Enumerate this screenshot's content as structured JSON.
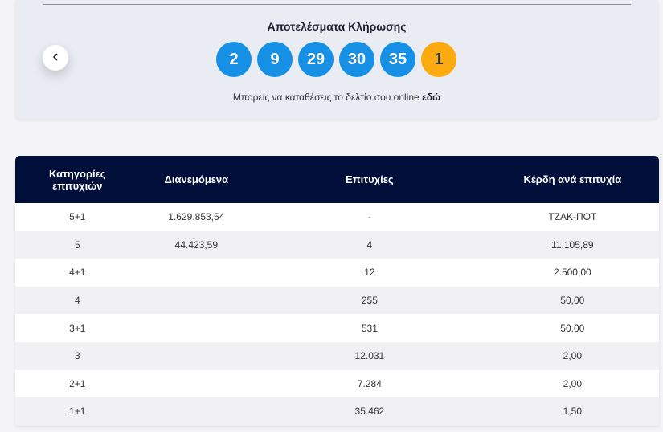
{
  "draw": {
    "title": "Αποτελέσματα Κλήρωσης",
    "numbers": [
      "2",
      "9",
      "29",
      "30",
      "35"
    ],
    "bonus": "1",
    "deposit_text": "Μπορείς να καταθέσεις το δελτίο σου online",
    "deposit_link": "εδώ",
    "prev_icon": "chevron-left-icon"
  },
  "table": {
    "headers": {
      "category": "Κατηγορίες επιτυχιών",
      "distributed": "Διανεμόμενα",
      "winners": "Επιτυχίες",
      "prize": "Κέρδη ανά επιτυχία"
    },
    "rows": [
      {
        "category": "5+1",
        "distributed": "1.629.853,54",
        "winners": "-",
        "prize": "ΤΖΑΚ-ΠΟΤ"
      },
      {
        "category": "5",
        "distributed": "44.423,59",
        "winners": "4",
        "prize": "11.105,89"
      },
      {
        "category": "4+1",
        "distributed": "",
        "winners": "12",
        "prize": "2.500,00"
      },
      {
        "category": "4",
        "distributed": "",
        "winners": "255",
        "prize": "50,00"
      },
      {
        "category": "3+1",
        "distributed": "",
        "winners": "531",
        "prize": "50,00"
      },
      {
        "category": "3",
        "distributed": "",
        "winners": "12.031",
        "prize": "2,00"
      },
      {
        "category": "2+1",
        "distributed": "",
        "winners": "7.284",
        "prize": "2,00"
      },
      {
        "category": "1+1",
        "distributed": "",
        "winners": "35.462",
        "prize": "1,50"
      }
    ]
  },
  "colors": {
    "ball_blue": "#1590e4",
    "ball_bonus": "#fbaa10",
    "header_navy": "#000e3a",
    "panel_bg": "#e9ecf3"
  }
}
